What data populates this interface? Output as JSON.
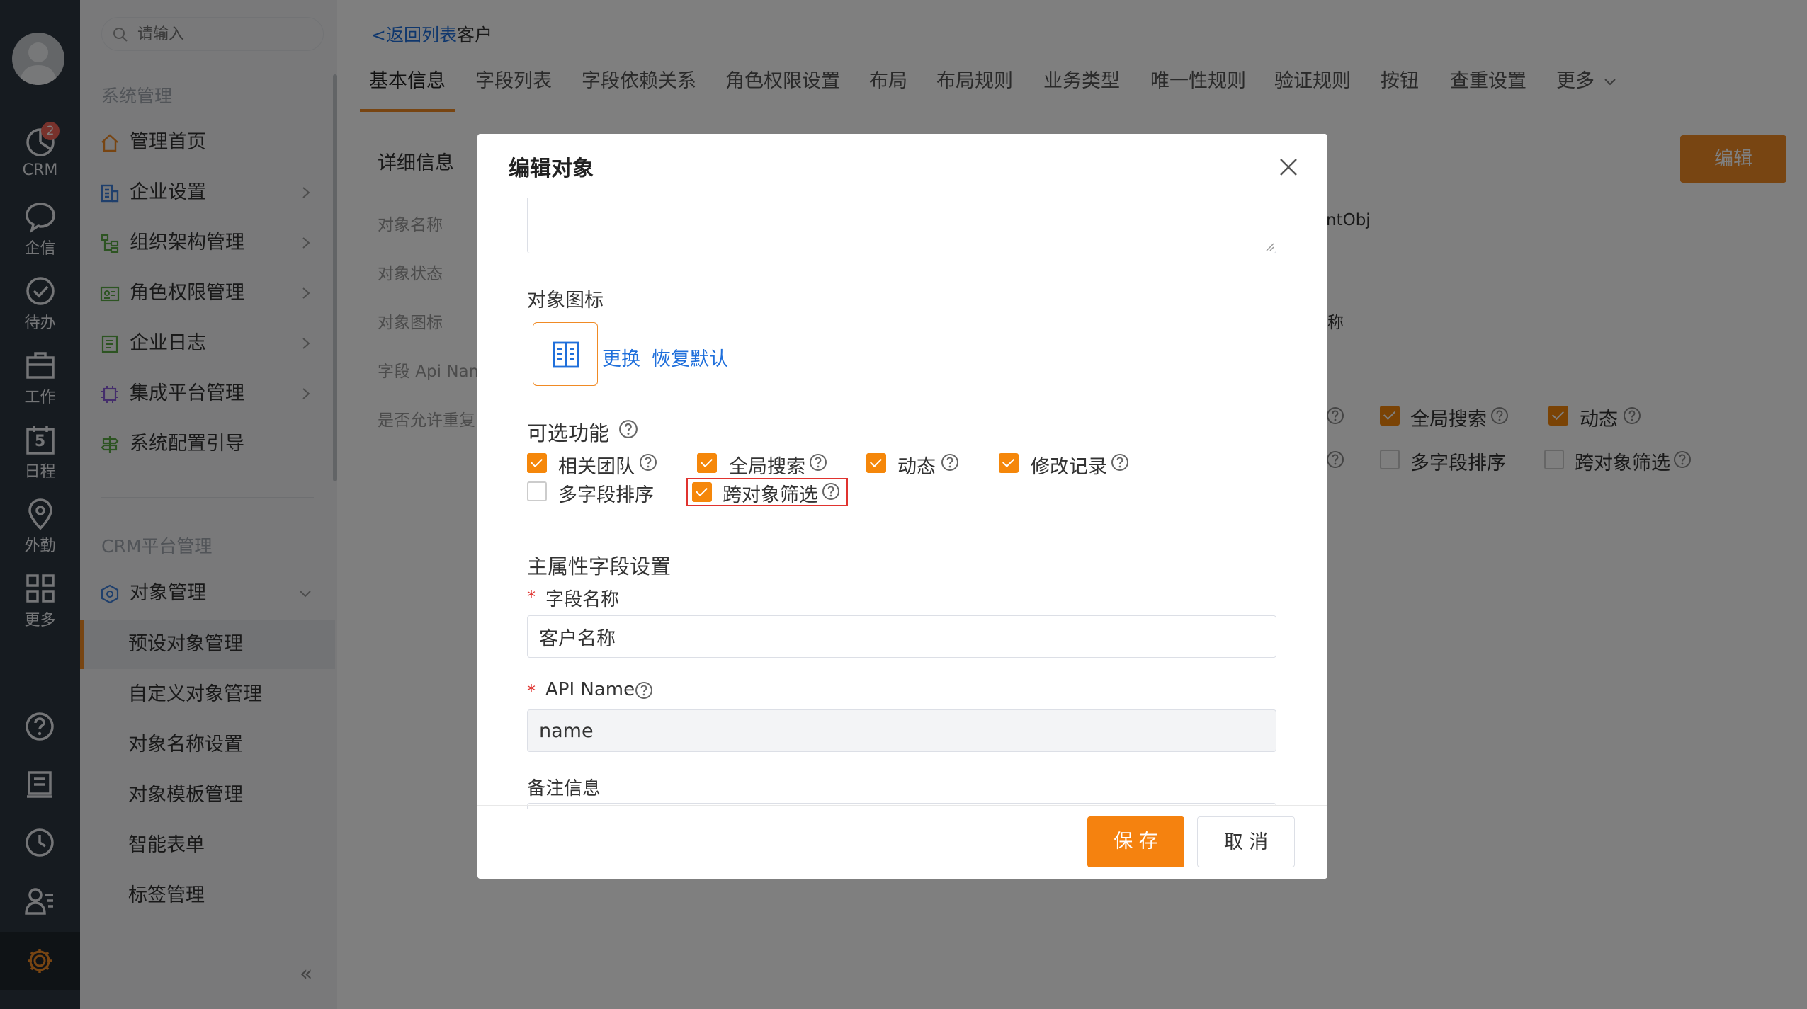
{
  "rail": {
    "items": [
      {
        "label": "CRM",
        "badge": "2"
      },
      {
        "label": "企信"
      },
      {
        "label": "待办"
      },
      {
        "label": "工作"
      },
      {
        "label": "日程",
        "day": "5"
      },
      {
        "label": "外勤"
      },
      {
        "label": "更多"
      }
    ]
  },
  "sidebar": {
    "search_placeholder": "请输入",
    "group1_title": "系统管理",
    "group1_items": [
      "管理首页",
      "企业设置",
      "组织架构管理",
      "角色权限管理",
      "企业日志",
      "集成平台管理",
      "系统配置引导"
    ],
    "group2_title": "CRM平台管理",
    "object_mgmt": "对象管理",
    "sub_items": [
      "预设对象管理",
      "自定义对象管理",
      "对象名称设置",
      "对象模板管理",
      "智能表单",
      "标签管理"
    ],
    "collapse_glyph": "«"
  },
  "main": {
    "back_link": "<返回列表",
    "breadcrumb_current": "客户",
    "tabs": [
      "基本信息",
      "字段列表",
      "字段依赖关系",
      "角色权限设置",
      "布局",
      "布局规则",
      "业务类型",
      "唯一性规则",
      "验证规则",
      "按钮",
      "查重设置",
      "更多"
    ],
    "section_title": "详细信息",
    "edit_button": "编辑",
    "detail_labels": [
      "对象名称",
      "对象状态",
      "对象图标",
      "字段 Api Name",
      "是否允许重复"
    ],
    "api_value_fragment": "ntObj",
    "name_value_fragment": "称",
    "bg_features": [
      {
        "label": "全局搜索",
        "checked": true
      },
      {
        "label": "动态",
        "checked": true
      },
      {
        "label": "多字段排序",
        "checked": false
      },
      {
        "label": "跨对象筛选",
        "checked": false
      }
    ]
  },
  "modal": {
    "title": "编辑对象",
    "icon_section_label": "对象图标",
    "change_link": "更换",
    "restore_link": "恢复默认",
    "features_label": "可选功能",
    "features": [
      {
        "label": "相关团队",
        "checked": true
      },
      {
        "label": "全局搜索",
        "checked": true
      },
      {
        "label": "动态",
        "checked": true
      },
      {
        "label": "修改记录",
        "checked": true
      },
      {
        "label": "多字段排序",
        "checked": false
      },
      {
        "label": "跨对象筛选",
        "checked": true,
        "highlighted": true
      }
    ],
    "main_attr_title": "主属性字段设置",
    "required_mark": "*",
    "field_name_label": "字段名称",
    "field_name_value": "客户名称",
    "api_name_label": "API Name",
    "api_name_value": "name",
    "remark_label": "备注信息",
    "save_button": "保 存",
    "cancel_button": "取 消"
  },
  "colors": {
    "accent": "#f08a24",
    "rail_bg": "#2d3640",
    "link": "#1f6fdb",
    "highlight_border": "#e0332f"
  }
}
